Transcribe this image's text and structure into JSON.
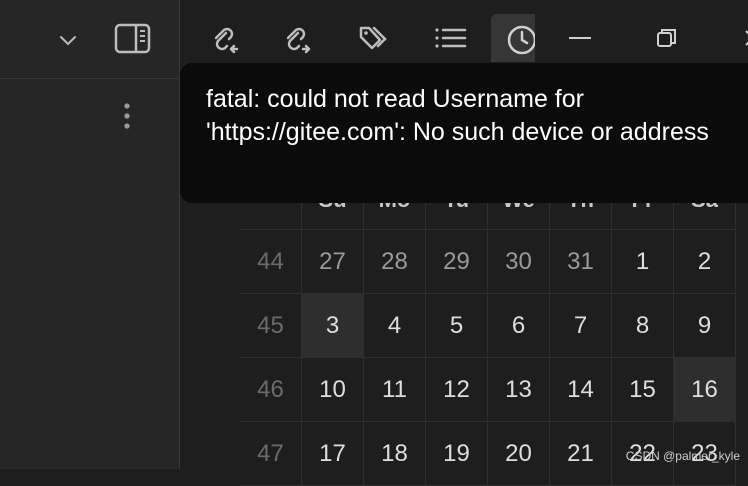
{
  "tooltip": {
    "message": "fatal: could not read Username for 'https://gitee.com': No such device or address"
  },
  "toolbar": {
    "buttons": [
      {
        "name": "link-back-icon",
        "active": false
      },
      {
        "name": "link-forward-icon",
        "active": false
      },
      {
        "name": "tags-icon",
        "active": false
      },
      {
        "name": "list-icon",
        "active": false
      },
      {
        "name": "clock-icon",
        "active": true
      }
    ],
    "window_controls": [
      "minimize-icon",
      "restore-icon",
      "close-icon"
    ]
  },
  "left_panel": {
    "icons": [
      "chevron-down-icon",
      "sidebar-right-icon",
      "more-vertical-icon"
    ]
  },
  "calendar": {
    "nav_next": "›",
    "weekday_headers": [
      "Su",
      "Mo",
      "Tu",
      "We",
      "Th",
      "Fr",
      "Sa"
    ],
    "weeks": [
      {
        "week": "44",
        "days": [
          "27",
          "28",
          "29",
          "30",
          "31",
          "1",
          "2"
        ]
      },
      {
        "week": "45",
        "days": [
          "3",
          "4",
          "5",
          "6",
          "7",
          "8",
          "9"
        ]
      },
      {
        "week": "46",
        "days": [
          "10",
          "11",
          "12",
          "13",
          "14",
          "15",
          "16"
        ]
      },
      {
        "week": "47",
        "days": [
          "17",
          "18",
          "19",
          "20",
          "21",
          "22",
          "23"
        ]
      }
    ],
    "highlighted_days": [
      "3",
      "16"
    ],
    "other_month_days": [
      "27",
      "28",
      "29",
      "30",
      "31"
    ]
  },
  "watermark": "CSDN @palmer_kyle",
  "colors": {
    "background": "#1e1e1e",
    "panel": "#262626",
    "tooltip": "#0b0b0b",
    "tooltip_text": "#ffffff",
    "highlight": "#2e2e2e"
  }
}
